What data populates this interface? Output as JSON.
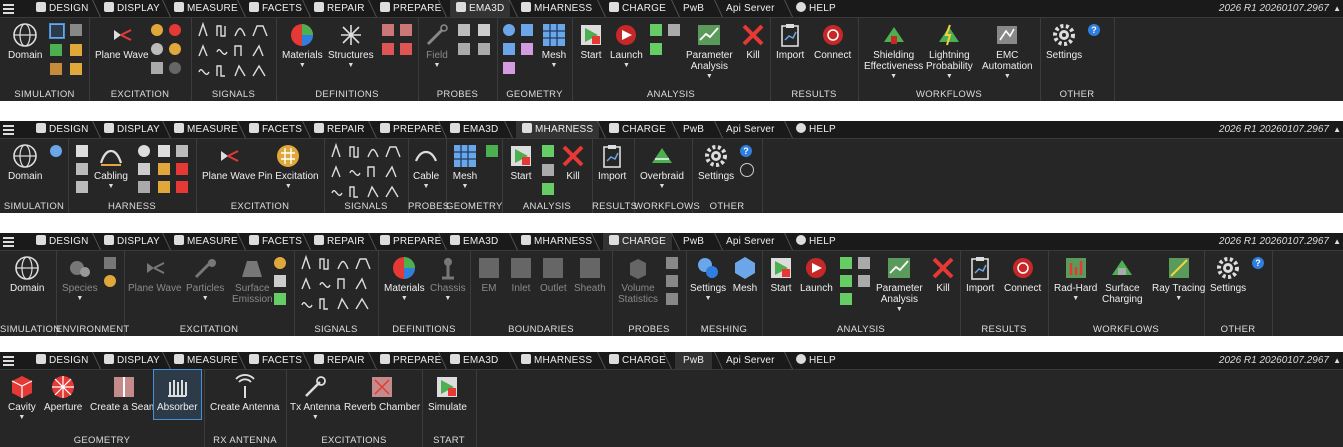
{
  "tabs": [
    "Design",
    "Display",
    "Measure",
    "Facets",
    "Repair",
    "Prepare",
    "EMA3D",
    "MHARNESS",
    "CHARGE",
    "PwB",
    "Api Server",
    "Help"
  ],
  "version": "2026 R1 20260107.2967",
  "ribbons": [
    {
      "active_tab": "EMA3D",
      "groups": {
        "simulation": "Simulation",
        "excitation": "Excitation",
        "signals": "Signals",
        "definitions": "Definitions",
        "probes": "Probes",
        "geometry": "Geometry",
        "analysis": "Analysis",
        "results": "Results",
        "workflows": "Workflows",
        "other": "Other"
      },
      "buttons": {
        "domain": "Domain",
        "plane_wave": "Plane Wave",
        "materials": "Materials",
        "structures": "Structures",
        "field": "Field",
        "mesh": "Mesh",
        "start": "Start",
        "launch": "Launch",
        "parameter": "Parameter",
        "analysis": "Analysis",
        "kill": "Kill",
        "import": "Import",
        "connect": "Connect",
        "shielding": "Shielding",
        "effectiveness": "Effectiveness",
        "lightning": "Lightning",
        "probability": "Probability",
        "emc": "EMC",
        "automation": "Automation",
        "settings": "Settings"
      }
    },
    {
      "active_tab": "MHARNESS",
      "groups": {
        "simulation": "Simulation",
        "harness": "Harness",
        "excitation": "Excitation",
        "signals": "Signals",
        "probes": "Probes",
        "geometry": "Geometry",
        "analysis": "Analysis",
        "results": "Results",
        "workflows": "Workflows",
        "other": "Other"
      },
      "buttons": {
        "domain": "Domain",
        "cabling": "Cabling",
        "plane_wave": "Plane Wave",
        "pin_excitation": "Pin Excitation",
        "cable": "Cable",
        "mesh": "Mesh",
        "start": "Start",
        "kill": "Kill",
        "import": "Import",
        "overbraid": "Overbraid",
        "settings": "Settings"
      }
    },
    {
      "active_tab": "CHARGE",
      "groups": {
        "simulation": "Simulation",
        "environment": "Environment",
        "excitation": "Excitation",
        "signals": "Signals",
        "definitions": "Definitions",
        "boundaries": "Boundaries",
        "probes": "Probes",
        "meshing": "Meshing",
        "analysis": "Analysis",
        "results": "Results",
        "workflows": "Workflows",
        "other": "Other"
      },
      "buttons": {
        "domain": "Domain",
        "species": "Species",
        "plane_wave": "Plane Wave",
        "particles": "Particles",
        "surface": "Surface",
        "emission": "Emission",
        "materials": "Materials",
        "chassis": "Chassis",
        "em": "EM",
        "inlet": "Inlet",
        "outlet": "Outlet",
        "sheath": "Sheath",
        "volume": "Volume",
        "statistics": "Statistics",
        "settings": "Settings",
        "mesh": "Mesh",
        "start": "Start",
        "launch": "Launch",
        "parameter": "Parameter",
        "analysis": "Analysis",
        "kill": "Kill",
        "import": "Import",
        "connect": "Connect",
        "rad_hard": "Rad-Hard",
        "surface2": "Surface",
        "charging": "Charging",
        "ray_tracing": "Ray Tracing",
        "settings2": "Settings"
      }
    },
    {
      "active_tab": "PwB",
      "groups": {
        "geometry": "Geometry",
        "rx_antenna": "Rx Antenna",
        "excitations": "Excitations",
        "start": "Start"
      },
      "buttons": {
        "cavity": "Cavity",
        "aperture": "Aperture",
        "create_seam": "Create a Seam",
        "absorber": "Absorber",
        "create_antenna": "Create Antenna",
        "tx_antenna": "Tx Antenna",
        "reverb_chamber": "Reverb Chamber",
        "simulate": "Simulate"
      }
    }
  ],
  "colors": {
    "bg": "#262626",
    "tabbar": "#1a1a1a",
    "accent": "#2f7fe0",
    "kill": "#e53935"
  },
  "icons": {
    "help": "?"
  }
}
